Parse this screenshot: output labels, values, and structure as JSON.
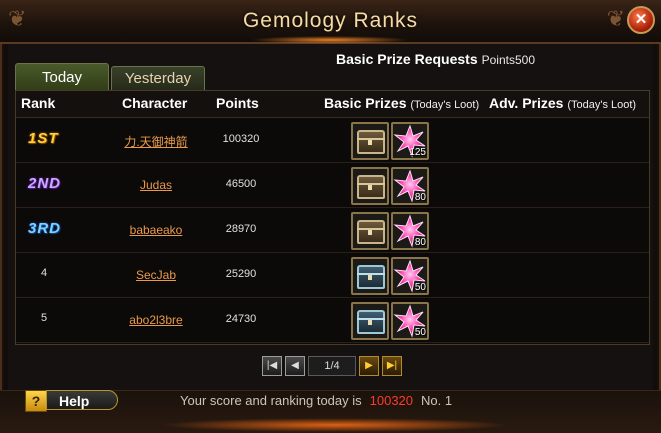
{
  "window": {
    "title": "Gemology Ranks",
    "close_label": "✕"
  },
  "prize_request": {
    "label": "Basic Prize Requests",
    "points_text": "Points500"
  },
  "tabs": [
    {
      "label": "Today"
    },
    {
      "label": "Yesterday"
    }
  ],
  "columns": {
    "rank": "Rank",
    "character": "Character",
    "points": "Points",
    "basic_prizes": "Basic Prizes",
    "basic_prizes_note": "(Today's Loot)",
    "adv_prizes": "Adv. Prizes",
    "adv_prizes_note": "(Today's Loot)"
  },
  "rows": [
    {
      "rank": "1ST",
      "character": "力.天御神箭",
      "points": "100320",
      "chest": "gold",
      "star_qty": "125"
    },
    {
      "rank": "2ND",
      "character": "Judas",
      "points": "46500",
      "chest": "gold",
      "star_qty": "80"
    },
    {
      "rank": "3RD",
      "character": "babaeako",
      "points": "28970",
      "chest": "gold",
      "star_qty": "80"
    },
    {
      "rank": "4",
      "character": "SecJab",
      "points": "25290",
      "chest": "blue",
      "star_qty": "50"
    },
    {
      "rank": "5",
      "character": "abo2l3bre",
      "points": "24730",
      "chest": "blue",
      "star_qty": "50"
    }
  ],
  "pager": {
    "page_text": "1/4"
  },
  "footer": {
    "help_icon": "?",
    "help_label": "Help",
    "score_prefix": "Your score and ranking today is",
    "score_value": "100320",
    "rank_text": "No. 1"
  },
  "colors": {
    "accent_gold": "#ffd23c",
    "score_red": "#ff3a2a",
    "link_orange": "#e89a4a"
  }
}
